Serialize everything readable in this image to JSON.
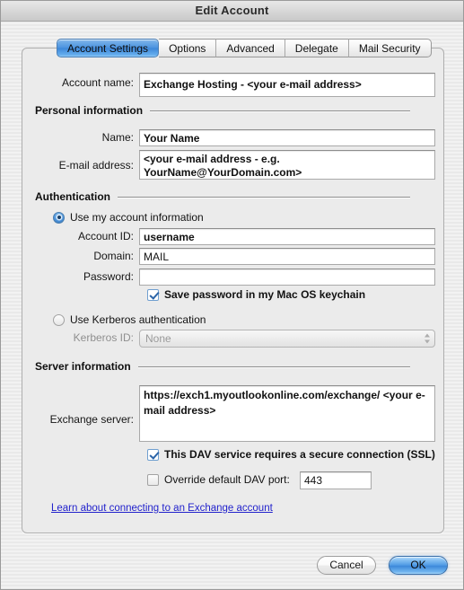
{
  "window": {
    "title": "Edit Account"
  },
  "tabs": [
    {
      "label": "Account Settings",
      "active": true
    },
    {
      "label": "Options",
      "active": false
    },
    {
      "label": "Advanced",
      "active": false
    },
    {
      "label": "Delegate",
      "active": false
    },
    {
      "label": "Mail Security",
      "active": false
    }
  ],
  "account_name": {
    "label": "Account name:",
    "value": "Exchange Hosting - <your e-mail address>"
  },
  "sections": {
    "personal": "Personal information",
    "authentication": "Authentication",
    "server": "Server information"
  },
  "personal": {
    "name_label": "Name:",
    "name_value": "Your Name",
    "email_label": "E-mail address:",
    "email_value": "<your e-mail address - e.g. YourName@YourDomain.com>"
  },
  "authentication": {
    "use_account_info_label": "Use my account information",
    "use_account_info_selected": true,
    "account_id_label": "Account ID:",
    "account_id_value": "username",
    "domain_label": "Domain:",
    "domain_value": "MAIL",
    "password_label": "Password:",
    "password_value": "",
    "save_password_label": "Save password in my Mac OS keychain",
    "save_password_checked": true,
    "use_kerberos_label": "Use Kerberos authentication",
    "use_kerberos_selected": false,
    "kerberos_id_label": "Kerberos ID:",
    "kerberos_id_value": "None"
  },
  "server": {
    "exchange_server_label": "Exchange server:",
    "exchange_server_value": "https://exch1.myoutlookonline.com/exchange/ <your e-mail address>",
    "ssl_label": "This DAV service requires a secure connection (SSL)",
    "ssl_checked": true,
    "override_port_label": "Override default DAV port:",
    "override_port_checked": false,
    "port_value": "443"
  },
  "help_link": "Learn about connecting to an Exchange account",
  "buttons": {
    "cancel": "Cancel",
    "ok": "OK"
  },
  "colors": {
    "accent_blue": "#4f96dd",
    "link_blue": "#2222cc",
    "window_bg": "#ececec",
    "panel_bg": "#ebebeb"
  },
  "icons": {
    "stepper_up": "stepper-up-arrow-icon",
    "stepper_down": "stepper-down-arrow-icon"
  }
}
